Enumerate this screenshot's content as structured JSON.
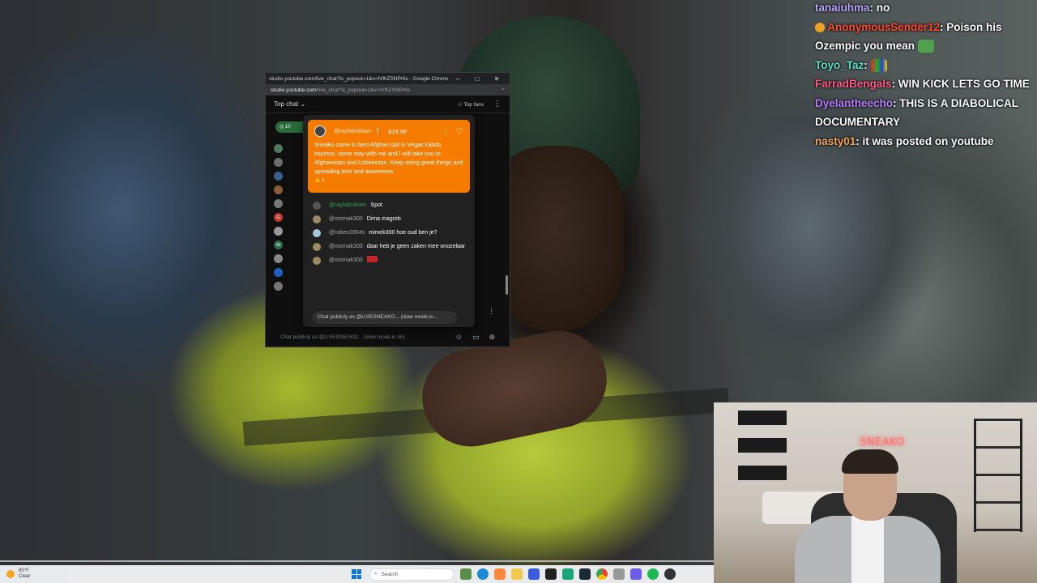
{
  "chat_window": {
    "title": "studio.youtube.com/live_chat?is_popout=1&v=tVlhZSNPr6s - Google Chrome",
    "url_host": "studio.youtube.com",
    "url_path": "/live_chat?is_popout=1&v=tVlhZSNPr6s",
    "header_mode": "Top chat",
    "top_fans_label": "Top fans",
    "input_placeholder": "Chat publicly as @LIVESNEAKO... (slow mode is on)"
  },
  "superchat": {
    "username": "@rayfabraham",
    "amount": "$19.99",
    "message": "Sneako come to best Afghan spit in Vegas kabob express. come stay with me and I will take you to Afghanistan and Uzbekistan. Keep doing great things and spreading love and awareness",
    "likes": "4",
    "replies": [
      {
        "user": "@rayfabraham",
        "msg": "Spot",
        "color": "#2ba640"
      },
      {
        "user": "@momak300",
        "msg": "Dima magreb",
        "color": "#aaaaaa"
      },
      {
        "user": "@ruben2004s",
        "msg": "mimek300 hoe oud ben je?",
        "color": "#aaaaaa"
      },
      {
        "user": "@momak300",
        "msg": "daar heb je geen zaken mee onozelaar",
        "color": "#aaaaaa"
      },
      {
        "user": "@momak300",
        "msg": "",
        "color": "#aaaaaa"
      }
    ],
    "input_placeholder": "Chat publicly as @LIVESNEAKO... (slow mode is..."
  },
  "twitch_chat": [
    {
      "user": "tanaiuhma",
      "color": "#b9a6ff",
      "msg": "no"
    },
    {
      "user": "AnonymousSender12",
      "color": "#ff4a2e",
      "msg": "Poison his Ozempic you mean"
    },
    {
      "user": "Toyo_Taz",
      "color": "#5be0c8",
      "msg": ""
    },
    {
      "user": "FarradBengals",
      "color": "#ff5a8a",
      "msg": "WIN KICK LETS GO  TIME"
    },
    {
      "user": "Dyelantheecho",
      "color": "#b57dff",
      "msg": "THIS IS A DIABOLICAL DOCUMENTARY"
    },
    {
      "user": "nasty01",
      "color": "#f2a65a",
      "msg": "it was posted on youtube"
    }
  ],
  "webcam": {
    "neon_sign": "SNEAKO"
  },
  "taskbar": {
    "weather_temp": "85°F",
    "weather_desc": "Clear",
    "search_placeholder": "Search"
  }
}
